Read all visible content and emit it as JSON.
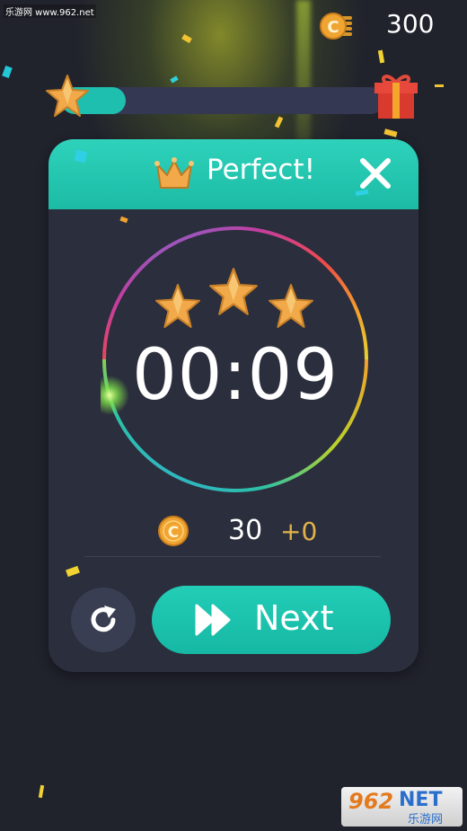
{
  "watermark": {
    "site": "乐游网 www.962.net",
    "logo_number": "962",
    "logo_net": "NET",
    "logo_cn": "乐游网"
  },
  "hud": {
    "coins": "300",
    "level_progress": 0.2
  },
  "result": {
    "title": "Perfect!",
    "time": "00:09",
    "stars_earned": 3,
    "reward_value": "30",
    "reward_bonus": "+0"
  },
  "buttons": {
    "next_label": "Next"
  },
  "icons": {
    "coin_stack": "coin-stack-icon",
    "star": "star-icon",
    "gift": "gift-icon",
    "crown": "crown-icon",
    "close": "close-icon",
    "coin": "coin-icon",
    "restart": "restart-icon",
    "fast_forward": "fast-forward-icon"
  },
  "colors": {
    "accent": "#1ebfae",
    "gold": "#e2b34a",
    "background": "#20222c",
    "card": "#2b2e3c"
  }
}
